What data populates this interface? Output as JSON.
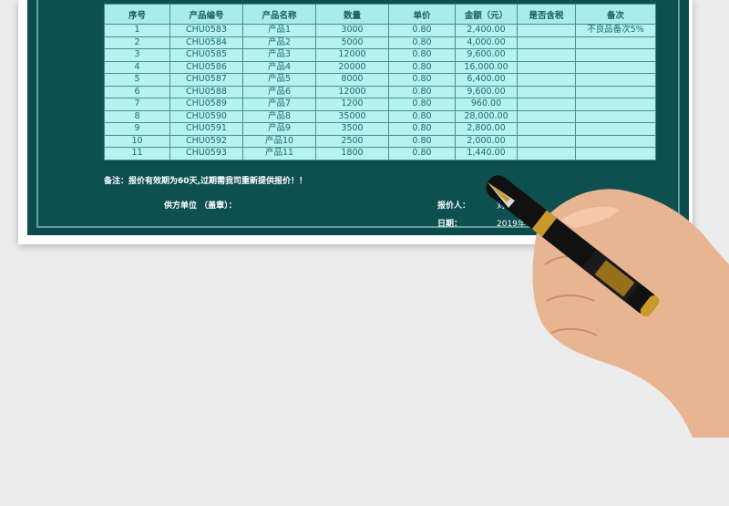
{
  "table": {
    "headers": [
      "序号",
      "产品编号",
      "产品名称",
      "数量",
      "单价",
      "金额（元）",
      "是否含税",
      "备次"
    ],
    "rows": [
      [
        "1",
        "CHU0583",
        "产品1",
        "3000",
        "0.80",
        "2,400.00",
        "",
        "不良品备次5%"
      ],
      [
        "2",
        "CHU0584",
        "产品2",
        "5000",
        "0.80",
        "4,000.00",
        "",
        ""
      ],
      [
        "3",
        "CHU0585",
        "产品3",
        "12000",
        "0.80",
        "9,600.00",
        "",
        ""
      ],
      [
        "4",
        "CHU0586",
        "产品4",
        "20000",
        "0.80",
        "16,000.00",
        "",
        ""
      ],
      [
        "5",
        "CHU0587",
        "产品5",
        "8000",
        "0.80",
        "6,400.00",
        "",
        ""
      ],
      [
        "6",
        "CHU0588",
        "产品6",
        "12000",
        "0.80",
        "9,600.00",
        "",
        ""
      ],
      [
        "7",
        "CHU0589",
        "产品7",
        "1200",
        "0.80",
        "960.00",
        "",
        ""
      ],
      [
        "8",
        "CHU0590",
        "产品8",
        "35000",
        "0.80",
        "28,000.00",
        "",
        ""
      ],
      [
        "9",
        "CHU0591",
        "产品9",
        "3500",
        "0.80",
        "2,800.00",
        "",
        ""
      ],
      [
        "10",
        "CHU0592",
        "产品10",
        "2500",
        "0.80",
        "2,000.00",
        "",
        ""
      ],
      [
        "11",
        "CHU0593",
        "产品11",
        "1800",
        "0.80",
        "1,440.00",
        "",
        ""
      ]
    ]
  },
  "footer": {
    "note": "备注：报价有效期为60天,过期需我司重新提供报价！！",
    "supplier_label": "供方单位 （盖章）：",
    "quoter_label": "报价人：",
    "quoter_name": "刘",
    "date_label": "日期：",
    "date_value": "2019年"
  },
  "colors": {
    "sheet_bg": "#0b4b4c",
    "header_bg": "#a9ecea",
    "cell_bg": "#b6f3f0",
    "cell_text": "#1d6a6a"
  }
}
